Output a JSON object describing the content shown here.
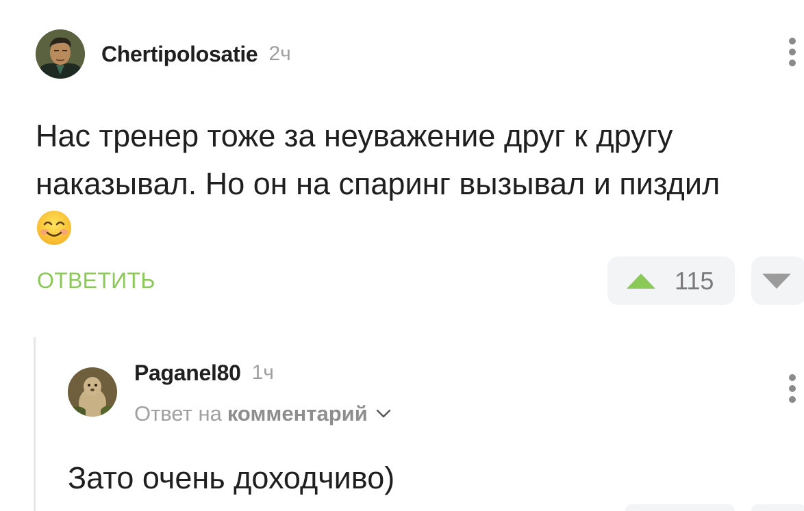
{
  "comment": {
    "username": "Chertipolosatie",
    "timestamp": "2ч",
    "text": "Нас тренер тоже за неуважение друг к другу наказывал. Но он на спаринг вызывал и пиздил",
    "emoji": "smiling-face-emoji",
    "reply_label": "ОТВЕТИТЬ",
    "rating": "115",
    "colors": {
      "accent": "#8ac858",
      "vote_bg": "#f3f4f6",
      "meta": "#9e9e9e"
    }
  },
  "reply": {
    "username": "Paganel80",
    "timestamp": "1ч",
    "reply_prefix": "Ответ на",
    "reply_target": "комментарий",
    "text": "Зато очень доходчиво)"
  }
}
